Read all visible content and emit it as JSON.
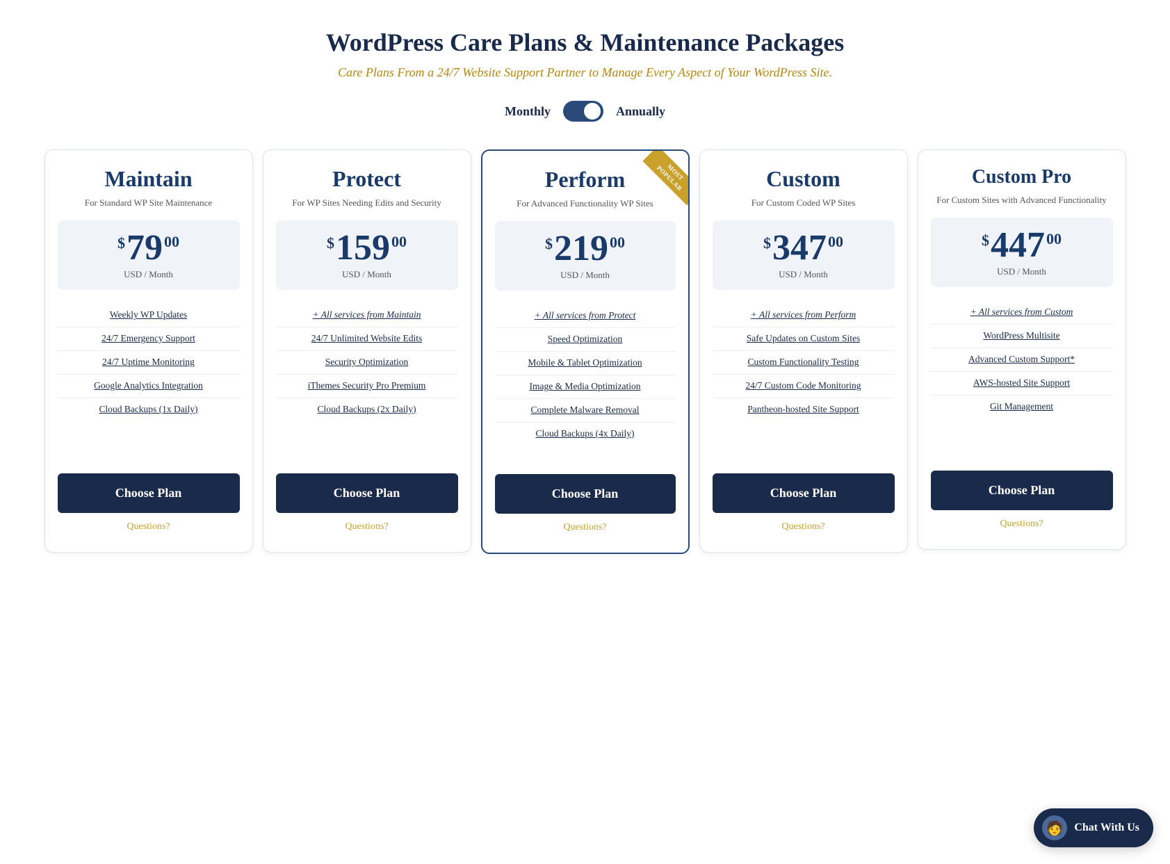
{
  "header": {
    "title": "WordPress Care Plans & Maintenance Packages",
    "subtitle": "Care Plans From a 24/7 Website Support Partner to Manage Every Aspect of Your WordPress Site."
  },
  "billing": {
    "monthly_label": "Monthly",
    "annually_label": "Annually",
    "active": "annually"
  },
  "plans": [
    {
      "id": "maintain",
      "name": "Maintain",
      "desc": "For Standard WP Site Maintenance",
      "price_dollar": "$",
      "price_amount": "79",
      "price_cents": "00",
      "price_period": "USD / Month",
      "features": [
        "Weekly WP Updates",
        "24/7 Emergency Support",
        "24/7 Uptime Monitoring",
        "Google Analytics Integration",
        "Cloud Backups (1x Daily)"
      ],
      "inherit": null,
      "most_popular": false,
      "choose_label": "Choose Plan",
      "questions_label": "Questions?"
    },
    {
      "id": "protect",
      "name": "Protect",
      "desc": "For WP Sites Needing Edits and Security",
      "price_dollar": "$",
      "price_amount": "159",
      "price_cents": "00",
      "price_period": "USD / Month",
      "features": [
        "+ All services from Maintain",
        "24/7 Unlimited Website Edits",
        "Security Optimization",
        "iThemes Security Pro Premium",
        "Cloud Backups (2x Daily)"
      ],
      "inherit": null,
      "most_popular": false,
      "choose_label": "Choose Plan",
      "questions_label": "Questions?"
    },
    {
      "id": "perform",
      "name": "Perform",
      "desc": "For Advanced Functionality WP Sites",
      "price_dollar": "$",
      "price_amount": "219",
      "price_cents": "00",
      "price_period": "USD / Month",
      "features": [
        "+ All services from Protect",
        "Speed Optimization",
        "Mobile & Tablet Optimization",
        "Image & Media Optimization",
        "Complete Malware Removal",
        "Cloud Backups (4x Daily)"
      ],
      "inherit": null,
      "most_popular": true,
      "most_popular_label": "MOST POPULAR",
      "choose_label": "Choose Plan",
      "questions_label": "Questions?"
    },
    {
      "id": "custom",
      "name": "Custom",
      "desc": "For Custom Coded WP Sites",
      "price_dollar": "$",
      "price_amount": "347",
      "price_cents": "00",
      "price_period": "USD / Month",
      "features": [
        "+ All services from Perform",
        "Safe Updates on Custom Sites",
        "Custom Functionality Testing",
        "24/7 Custom Code Monitoring",
        "Pantheon-hosted Site Support"
      ],
      "inherit": null,
      "most_popular": false,
      "choose_label": "Choose Plan",
      "questions_label": "Questions?"
    },
    {
      "id": "custom_pro",
      "name": "Custom Pro",
      "desc": "For Custom Sites with Advanced Functionality",
      "price_dollar": "$",
      "price_amount": "447",
      "price_cents": "00",
      "price_period": "USD / Month",
      "features": [
        "+ All services from Custom",
        "WordPress Multisite",
        "Advanced Custom Support*",
        "AWS-hosted Site Support",
        "Git Management"
      ],
      "inherit": null,
      "most_popular": false,
      "choose_label": "Choose Plan",
      "questions_label": "Questions?"
    }
  ],
  "chat_widget": {
    "label": "Chat With Us"
  }
}
